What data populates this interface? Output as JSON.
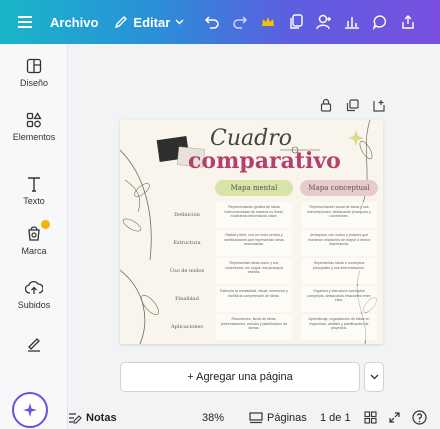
{
  "toolbar": {
    "archivo": "Archivo",
    "editar": "Editar"
  },
  "sidebar": {
    "items": [
      {
        "label": "Diseño",
        "icon": "layout-icon"
      },
      {
        "label": "Elementos",
        "icon": "elements-icon"
      },
      {
        "label": "Texto",
        "icon": "text-icon"
      },
      {
        "label": "Marca",
        "icon": "brand-icon"
      },
      {
        "label": "Subidos",
        "icon": "upload-icon"
      },
      {
        "label": "",
        "icon": "draw-icon"
      }
    ]
  },
  "slide": {
    "title_line1": "Cuadro",
    "title_line2": "comparativo",
    "col_a": "Mapa mental",
    "col_b": "Mapa conceptual",
    "rows": [
      {
        "label": "Definición",
        "a": "Representación gráfica de ideas interconectadas de manera no lineal, mostrando información clave.",
        "b": "Representación visual de ideas y sus interrelaciones, destacando jerarquías y conexiones."
      },
      {
        "label": "Estructura",
        "a": "Radial y libre, con un nodo central y ramificaciones que representan ideas secundarias.",
        "b": "Jerárquica, con nodos y enlaces que muestran relaciones de mayor a menor importancia."
      },
      {
        "label": "Uso de nodos",
        "a": "Representan ideas clave y sus conexiones, sin seguir una jerarquía estricta.",
        "b": "Representan ideas o conceptos principales y sus interrelaciones."
      },
      {
        "label": "Finalidad",
        "a": "Estimula la creatividad, visual, memoriza y facilita la comprensión de ideas.",
        "b": "Organiza y estructura conceptos complejos, destacando relaciones entre ellos."
      },
      {
        "label": "Aplicaciones",
        "a": "Resúmenes, lluvia de ideas, presentaciones, estudio y planificación de tareas.",
        "b": "Aprendizaje, organización de ideas en esquemas, análisis y planificación de proyectos."
      }
    ]
  },
  "add_page": "+ Agregar una página",
  "bottom": {
    "notes": "Notas",
    "zoom": "38%",
    "pages": "Páginas",
    "page_count": "1 de 1"
  },
  "colors": {
    "accent": "#6c4fe0",
    "title_pink": "#b4406d",
    "header_green": "#d8e3a6",
    "header_pink": "#e8c9cc"
  }
}
